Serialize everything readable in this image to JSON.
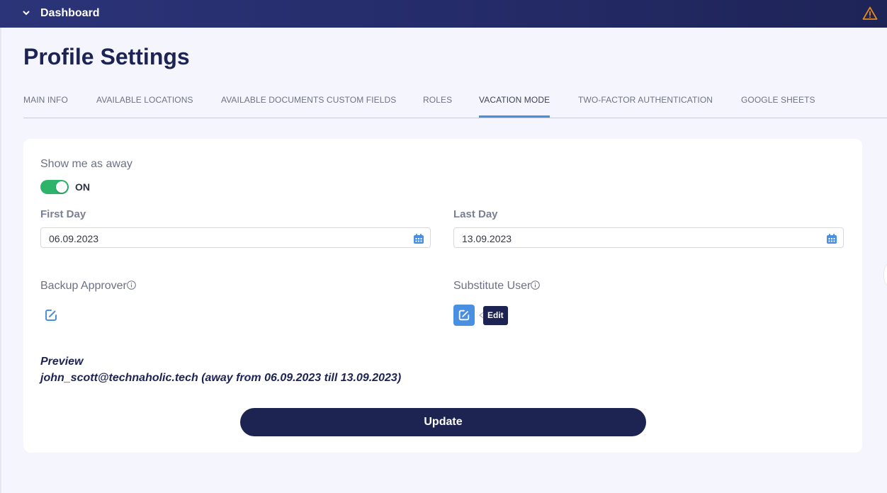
{
  "topbar": {
    "title": "Dashboard",
    "more_glyph": "⋮"
  },
  "page": {
    "title": "Profile Settings"
  },
  "tabs": [
    {
      "label": "MAIN INFO",
      "active": false
    },
    {
      "label": "AVAILABLE LOCATIONS",
      "active": false
    },
    {
      "label": "AVAILABLE DOCUMENTS CUSTOM FIELDS",
      "active": false
    },
    {
      "label": "ROLES",
      "active": false
    },
    {
      "label": "VACATION MODE",
      "active": true
    },
    {
      "label": "TWO-FACTOR AUTHENTICATION",
      "active": false
    },
    {
      "label": "GOOGLE SHEETS",
      "active": false
    }
  ],
  "vacation": {
    "away_label": "Show me as away",
    "toggle_state": "ON",
    "first_day_label": "First Day",
    "first_day_value": "06.09.2023",
    "last_day_label": "Last Day",
    "last_day_value": "13.09.2023",
    "backup_approver_label": "Backup Approver",
    "substitute_user_label": "Substitute User",
    "edit_tooltip": "Edit",
    "preview_title": "Preview",
    "preview_text": "john_scott@technaholic.tech (away from 06.09.2023 till 13.09.2023)",
    "update_label": "Update"
  },
  "colors": {
    "brand_dark": "#1d2352",
    "accent_blue": "#4a90e2",
    "toggle_on": "#2eb36a",
    "warning": "#e08a1e"
  }
}
